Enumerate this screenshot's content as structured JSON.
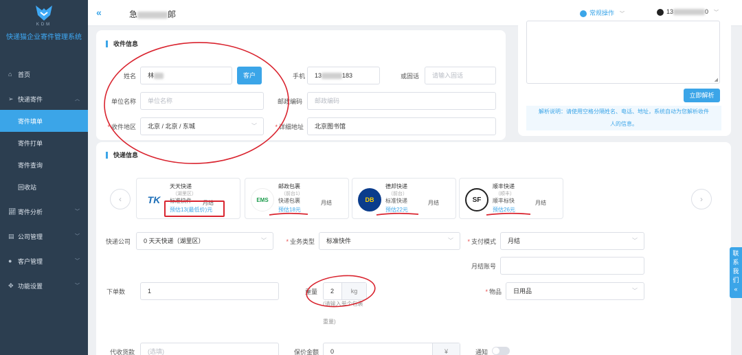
{
  "app": {
    "logo_text": "KDM",
    "title": "快递猫企业寄件管理系统"
  },
  "sidebar": {
    "items": [
      {
        "label": "首页",
        "icon": "home-icon"
      },
      {
        "label": "快递寄件",
        "icon": "send-icon"
      },
      {
        "label": "寄件填单",
        "active": true
      },
      {
        "label": "寄件打单"
      },
      {
        "label": "寄件查询"
      },
      {
        "label": "回收站"
      },
      {
        "label": "寄件分析",
        "icon": "chart-icon"
      },
      {
        "label": "公司管理",
        "icon": "building-icon"
      },
      {
        "label": "客户管理",
        "icon": "user-icon"
      },
      {
        "label": "功能设置",
        "icon": "settings-icon"
      }
    ]
  },
  "topbar": {
    "collapse_icon": "«",
    "title_prefix": "急",
    "title_suffix": "郞",
    "quick_ops": "常规操作",
    "user_prefix": "13",
    "user_suffix": "0"
  },
  "recipient": {
    "section_title": "收件信息",
    "name_label": "姓名",
    "name_value": "林",
    "customer_btn": "客户",
    "phone_label": "手机",
    "phone_prefix": "13",
    "phone_suffix": "183",
    "tel_label": "或固话",
    "tel_placeholder": "请输入固话",
    "company_label": "单位名称",
    "company_placeholder": "单位名称",
    "zip_label": "邮政编码",
    "zip_placeholder": "邮政编码",
    "region_label": "收件地区",
    "region_value": "北京 / 北京 / 东城",
    "address_label": "详细地址",
    "address_value": "北京图书馆"
  },
  "parse": {
    "button": "立即解析",
    "hint_line1": "解析说明：请使用空格分隔姓名、电话、地址，系统自动为您解析收件",
    "hint_line2": "人的信息。"
  },
  "express": {
    "section_title": "快递信息",
    "carriers": [
      {
        "name": "天天快递",
        "sub": "（湖里区）",
        "product": "标准快件",
        "pay": "月结",
        "price": "预估13(最低价)元",
        "logo": "TK"
      },
      {
        "name": "邮政包裹",
        "sub": "（前台1）",
        "product": "快递包裹",
        "pay": "月结",
        "price": "预估18元",
        "logo": "EMS"
      },
      {
        "name": "德邦快递",
        "sub": "（前台）",
        "product": "标准快递",
        "pay": "月结",
        "price": "预估22元",
        "logo": "DB"
      },
      {
        "name": "顺丰快递",
        "sub": "（顺丰）",
        "product": "顺丰标快",
        "pay": "月结",
        "price": "预估26元",
        "logo": "SF"
      }
    ],
    "company_label": "快递公司",
    "company_value": "0 天天快递（湖里区）",
    "service_label": "业务类型",
    "service_value": "标准快件",
    "pay_label": "支付模式",
    "pay_value": "月结",
    "account_label": "月结账号",
    "count_label": "下单数",
    "count_value": "1",
    "weight_label": "重量",
    "weight_value": "2",
    "weight_unit": "kg",
    "weight_note_1": "(请输入单个包裹",
    "weight_note_2": "重量)",
    "goods_label": "物品",
    "goods_value": "日用品",
    "cod_label": "代收货款",
    "cod_placeholder": "(选填)",
    "insure_label": "保价金额",
    "insure_value": "0",
    "insure_unit": "¥",
    "notify_label": "通知"
  },
  "contact_tab": [
    "联",
    "系",
    "我",
    "们",
    "«"
  ],
  "colors": {
    "accent": "#3ba5e8",
    "sidebar": "#2c3e50",
    "annotation": "#d9232e"
  }
}
